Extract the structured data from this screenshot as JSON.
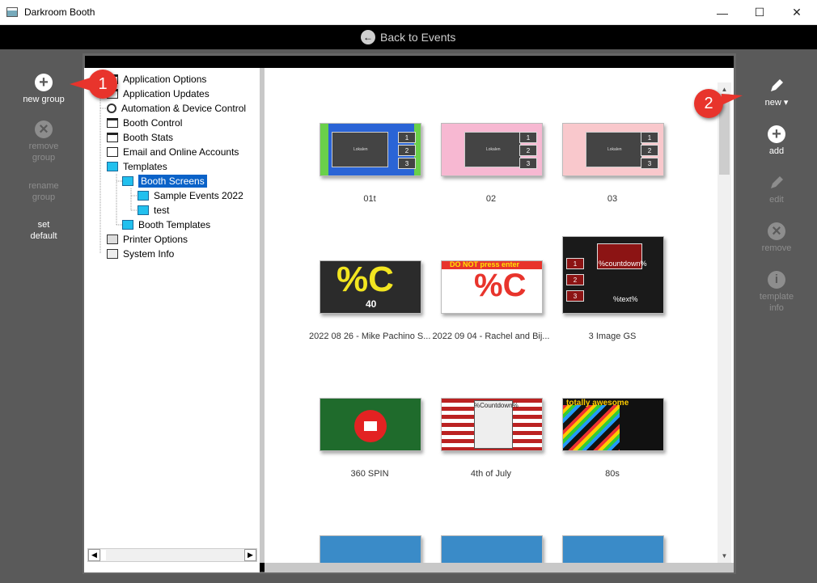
{
  "window": {
    "title": "Darkroom Booth",
    "minimize": "—",
    "maximize": "☐",
    "close": "✕"
  },
  "topbar": {
    "back_label": "Back to Events",
    "back_icon": "←"
  },
  "left_sidebar": {
    "new_group": "new group",
    "remove_group_1": "remove",
    "remove_group_2": "group",
    "rename_group_1": "rename",
    "rename_group_2": "group",
    "set_default_1": "set",
    "set_default_2": "default"
  },
  "right_sidebar": {
    "new": "new ▾",
    "add": "add",
    "edit": "edit",
    "remove": "remove",
    "template_info_1": "template",
    "template_info_2": "info"
  },
  "tree": [
    {
      "label": "Application Options"
    },
    {
      "label": "Application Updates"
    },
    {
      "label": "Automation & Device Control"
    },
    {
      "label": "Booth Control"
    },
    {
      "label": "Booth Stats"
    },
    {
      "label": "Email and Online Accounts"
    },
    {
      "label": "Templates"
    },
    {
      "label": "Booth Screens"
    },
    {
      "label": "Sample Events 2022"
    },
    {
      "label": "test"
    },
    {
      "label": "Booth Templates"
    },
    {
      "label": "Printer Options"
    },
    {
      "label": "System Info"
    }
  ],
  "scroll": {
    "left": "◀",
    "right": "▶",
    "up": "▲",
    "down": "▼"
  },
  "tiles": [
    {
      "label": "01t",
      "scr_text": "Lokalen",
      "nums": [
        "1",
        "2",
        "3"
      ]
    },
    {
      "label": "02",
      "scr_text": "Lokalen",
      "nums": [
        "1",
        "2",
        "3"
      ]
    },
    {
      "label": "03",
      "scr_text": "Lokalen",
      "nums": [
        "1",
        "2",
        "3"
      ]
    },
    {
      "label": "2022 08 26 - Mike Pachino S...",
      "big": "%C",
      "sub": "40"
    },
    {
      "label": "2022 09 04 - Rachel and Bij...",
      "big": "%C",
      "banner": "DO NOT press enter"
    },
    {
      "label": "3 Image GS",
      "cd": "%countdown%",
      "txt": "%text%",
      "nums": [
        "1",
        "2",
        "3"
      ]
    },
    {
      "label": "360 SPIN"
    },
    {
      "label": "4th of July",
      "cd": "%Countdown%"
    },
    {
      "label": "80s",
      "banner": "totally awesome"
    }
  ],
  "callouts": [
    "1",
    "2"
  ],
  "colors": {
    "accent_red": "#e8342c",
    "selected": "#0a62c8"
  }
}
